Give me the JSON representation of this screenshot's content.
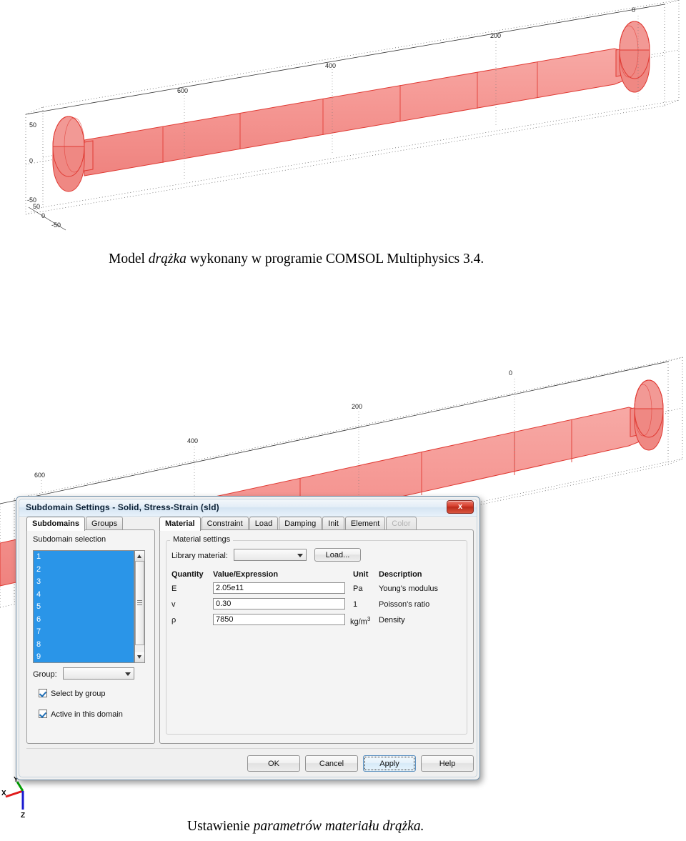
{
  "figure_top": {
    "name": "comsol-3d-model-view-top",
    "axis_labels_length": [
      "600",
      "400",
      "200",
      "0"
    ],
    "axis_labels_vertical": [
      "50",
      "0",
      "-50"
    ],
    "axis_labels_depth": [
      "50",
      "0",
      "-50"
    ],
    "geometry_color": "#f4918e",
    "edge_color": "#e03a33"
  },
  "caption_top": {
    "part1": "Model ",
    "italic": "drążka",
    "part2": " wykonany w programie COMSOL Multiphysics 3.4."
  },
  "figure_bottom": {
    "name": "comsol-3d-model-view-bottom",
    "axis_labels_length": [
      "600",
      "400",
      "200",
      "0"
    ],
    "geometry_color": "#f4918e",
    "edge_color": "#e03a33",
    "triad": {
      "x_label": "X",
      "y_label": "Y",
      "z_label": "Z",
      "x_color": "#e01b1b",
      "y_color": "#00a000",
      "z_color": "#1a1ad0"
    }
  },
  "caption_bottom": {
    "part1": "Ustawienie ",
    "italic": "parametrów materiału drążka."
  },
  "dialog": {
    "title": "Subdomain Settings - Solid, Stress-Strain (sld)",
    "close_label": "x",
    "left_tabs": [
      {
        "label": "Subdomains",
        "active": true,
        "disabled": false
      },
      {
        "label": "Groups",
        "active": false,
        "disabled": false
      }
    ],
    "right_tabs": [
      {
        "label": "Material",
        "active": true,
        "disabled": false
      },
      {
        "label": "Constraint",
        "active": false,
        "disabled": false
      },
      {
        "label": "Load",
        "active": false,
        "disabled": false
      },
      {
        "label": "Damping",
        "active": false,
        "disabled": false
      },
      {
        "label": "Init",
        "active": false,
        "disabled": false
      },
      {
        "label": "Element",
        "active": false,
        "disabled": false
      },
      {
        "label": "Color",
        "active": false,
        "disabled": true
      }
    ],
    "left_panel": {
      "group_title": "Subdomain selection",
      "list_items": [
        "1",
        "2",
        "3",
        "4",
        "5",
        "6",
        "7",
        "8",
        "9"
      ],
      "group_label": "Group:",
      "group_value": "",
      "checkboxes": [
        {
          "label": "Select by group",
          "checked": true
        },
        {
          "label": "Active in this domain",
          "checked": true
        }
      ]
    },
    "right_panel": {
      "group_title": "Material settings",
      "library_label": "Library material:",
      "library_value": "",
      "load_button": "Load...",
      "table": {
        "headers": [
          "Quantity",
          "Value/Expression",
          "Unit",
          "Description"
        ],
        "rows": [
          {
            "quantity": "E",
            "value": "2.05e11",
            "unit": "Pa",
            "unit_sup": "",
            "description": "Young's modulus"
          },
          {
            "quantity": "v",
            "value": "0.30",
            "unit": "1",
            "unit_sup": "",
            "description": "Poisson's ratio"
          },
          {
            "quantity": "ρ",
            "value": "7850",
            "unit": "kg/m",
            "unit_sup": "3",
            "description": "Density"
          }
        ]
      }
    },
    "buttons": [
      {
        "label": "OK",
        "focused": false
      },
      {
        "label": "Cancel",
        "focused": false
      },
      {
        "label": "Apply",
        "focused": true
      },
      {
        "label": "Help",
        "focused": false
      }
    ]
  },
  "colors": {
    "selection_blue": "#2a95e8",
    "close_red": "#d7412f",
    "dialog_bg": "#f0f0f0"
  }
}
